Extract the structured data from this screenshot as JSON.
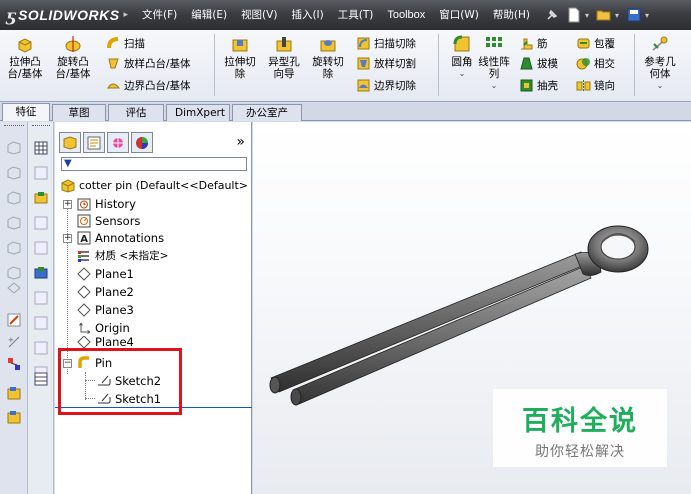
{
  "app": {
    "logo_mark": "ƽ",
    "logo_text": "SOLIDWORKS"
  },
  "menu": [
    "文件(F)",
    "编辑(E)",
    "视图(V)",
    "插入(I)",
    "工具(T)",
    "Toolbox",
    "窗口(W)",
    "帮助(H)"
  ],
  "ribbon": {
    "extrude_boss": "拉伸凸\n台/基体",
    "revolve_boss": "旋转凸\n台/基体",
    "sweep": "扫描",
    "loft": "放样凸台/基体",
    "boundary_boss": "边界凸台/基体",
    "extrude_cut": "拉伸切\n除",
    "hole_wizard": "异型孔\n向导",
    "revolve_cut": "旋转切\n除",
    "sweep_cut": "扫描切除",
    "loft_cut": "放样切割",
    "boundary_cut": "边界切除",
    "fillet": "圆角",
    "linear_pattern": "线性阵\n列",
    "rib": "筋",
    "draft": "拔模",
    "shell": "抽壳",
    "wrap": "包覆",
    "intersect": "相交",
    "mirror": "镜向",
    "ref_geometry": "参考几\n何体"
  },
  "tabs": [
    "特征",
    "草图",
    "评估",
    "DimXpert",
    "办公室产品"
  ],
  "tree": {
    "root": "cotter pin  (Default<<Default>",
    "items": [
      {
        "label": "History",
        "icon": "history-icon"
      },
      {
        "label": "Sensors",
        "icon": "sensors-icon"
      },
      {
        "label": "Annotations",
        "icon": "annotations-icon"
      },
      {
        "label": "材质 <未指定>",
        "icon": "material-icon"
      },
      {
        "label": "Plane1",
        "icon": "plane-icon"
      },
      {
        "label": "Plane2",
        "icon": "plane-icon"
      },
      {
        "label": "Plane3",
        "icon": "plane-icon"
      },
      {
        "label": "Origin",
        "icon": "origin-icon"
      },
      {
        "label": "Plane4",
        "icon": "plane-icon"
      },
      {
        "label": "Pin",
        "icon": "sweep-feature-icon"
      },
      {
        "label": "Sketch2",
        "icon": "sketch-icon"
      },
      {
        "label": "Sketch1",
        "icon": "sketch-icon"
      }
    ],
    "more_glyph": "»"
  },
  "watermark": {
    "title": "百科全说",
    "subtitle": "助你轻松解决"
  },
  "colors": {
    "highlight": "#e0121b",
    "watermark_green": "#1fae5b",
    "titlebar": "#3b3d42"
  }
}
